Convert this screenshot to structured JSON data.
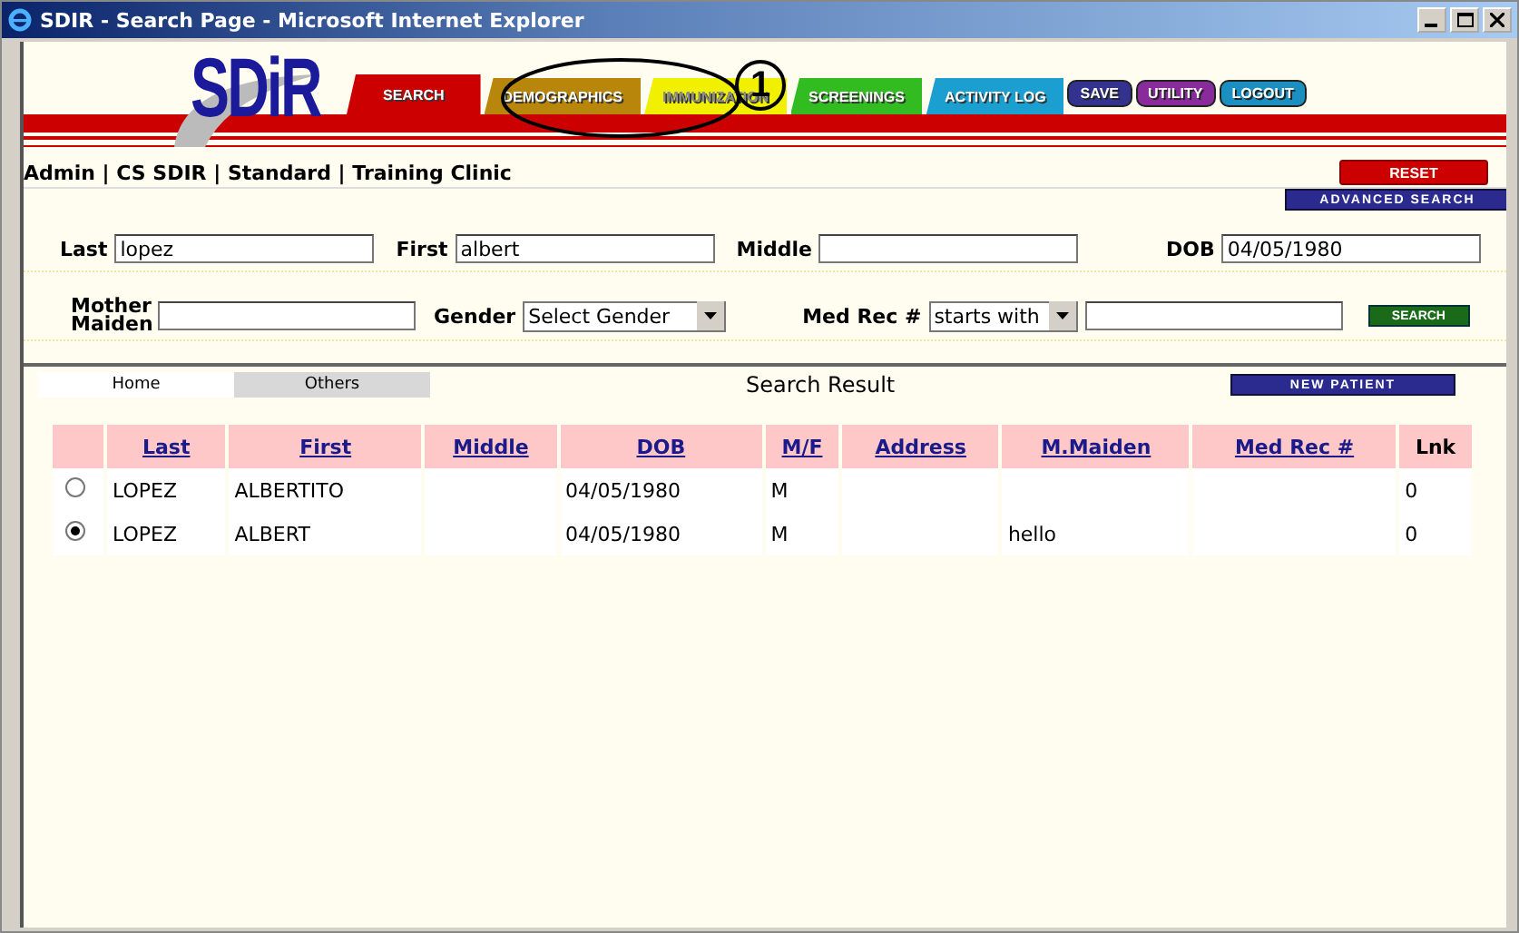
{
  "window": {
    "title": "SDIR - Search Page - Microsoft Internet Explorer"
  },
  "nav_tabs": [
    {
      "label": "SEARCH",
      "kind": "tab",
      "color": "#cc0000"
    },
    {
      "label": "DEMOGRAPHICS",
      "kind": "tab",
      "color": "#b8860b"
    },
    {
      "label": "IMMUNIZATION",
      "kind": "tab",
      "color": "#f0f000"
    },
    {
      "label": "SCREENINGS",
      "kind": "tab",
      "color": "#33bb22"
    },
    {
      "label": "ACTIVITY LOG",
      "kind": "tab",
      "color": "#1a9fd0"
    },
    {
      "label": "SAVE",
      "kind": "pill",
      "color": "#33338f"
    },
    {
      "label": "UTILITY",
      "kind": "pill",
      "color": "#8a2b9c"
    },
    {
      "label": "LOGOUT",
      "kind": "pill",
      "color": "#1a8fc0"
    }
  ],
  "annotation": {
    "label": "1"
  },
  "logo": {
    "text": "SDiR"
  },
  "breadcrumb": "Admin | CS SDIR | Standard | Training Clinic",
  "reset_button": "RESET",
  "advanced_search_button": "ADVANCED SEARCH",
  "form": {
    "last": {
      "label": "Last",
      "value": "lopez"
    },
    "first": {
      "label": "First",
      "value": "albert"
    },
    "middle": {
      "label": "Middle"
    },
    "dob": {
      "label": "DOB",
      "value": "04/05/1980"
    },
    "mother_maiden": {
      "label": "Mother Maiden"
    },
    "gender": {
      "label": "Gender",
      "value": "Select Gender"
    },
    "med_rec": {
      "label": "Med Rec #",
      "mode": "starts with"
    },
    "search_button": "SEARCH"
  },
  "result_tabs": [
    {
      "label": "Home",
      "selected": true
    },
    {
      "label": "Others",
      "selected": false
    }
  ],
  "result_title": "Search Result",
  "new_patient_button": "NEW PATIENT",
  "table": {
    "columns": [
      "Last",
      "First",
      "Middle",
      "DOB",
      "M/F",
      "Address",
      "M.Maiden",
      "Med Rec #",
      "Lnk"
    ],
    "rows": [
      {
        "selected": false,
        "cells": [
          "LOPEZ",
          "ALBERTITO",
          "",
          "04/05/1980",
          "M",
          "",
          "",
          "",
          "0"
        ]
      },
      {
        "selected": true,
        "cells": [
          "LOPEZ",
          "ALBERT",
          "",
          "04/05/1980",
          "M",
          "",
          "hello",
          "",
          "0"
        ]
      }
    ]
  }
}
